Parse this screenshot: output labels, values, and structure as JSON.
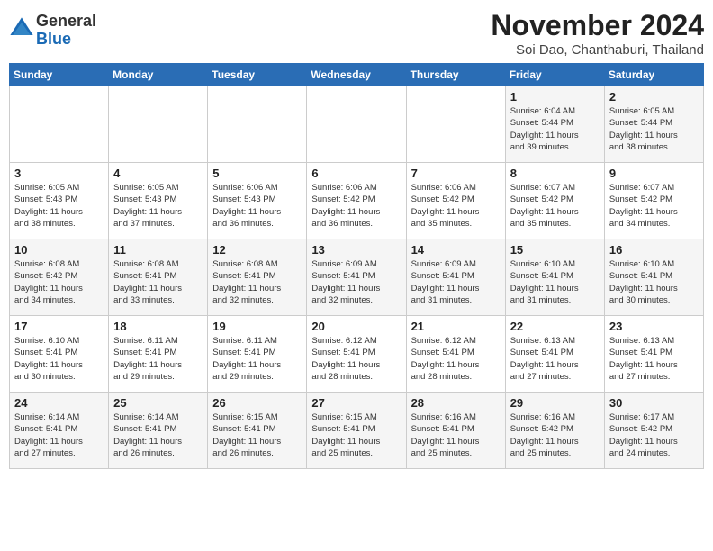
{
  "header": {
    "logo_general": "General",
    "logo_blue": "Blue",
    "month_title": "November 2024",
    "location": "Soi Dao, Chanthaburi, Thailand"
  },
  "days_of_week": [
    "Sunday",
    "Monday",
    "Tuesday",
    "Wednesday",
    "Thursday",
    "Friday",
    "Saturday"
  ],
  "weeks": [
    [
      {
        "day": "",
        "info": ""
      },
      {
        "day": "",
        "info": ""
      },
      {
        "day": "",
        "info": ""
      },
      {
        "day": "",
        "info": ""
      },
      {
        "day": "",
        "info": ""
      },
      {
        "day": "1",
        "info": "Sunrise: 6:04 AM\nSunset: 5:44 PM\nDaylight: 11 hours\nand 39 minutes."
      },
      {
        "day": "2",
        "info": "Sunrise: 6:05 AM\nSunset: 5:44 PM\nDaylight: 11 hours\nand 38 minutes."
      }
    ],
    [
      {
        "day": "3",
        "info": "Sunrise: 6:05 AM\nSunset: 5:43 PM\nDaylight: 11 hours\nand 38 minutes."
      },
      {
        "day": "4",
        "info": "Sunrise: 6:05 AM\nSunset: 5:43 PM\nDaylight: 11 hours\nand 37 minutes."
      },
      {
        "day": "5",
        "info": "Sunrise: 6:06 AM\nSunset: 5:43 PM\nDaylight: 11 hours\nand 36 minutes."
      },
      {
        "day": "6",
        "info": "Sunrise: 6:06 AM\nSunset: 5:42 PM\nDaylight: 11 hours\nand 36 minutes."
      },
      {
        "day": "7",
        "info": "Sunrise: 6:06 AM\nSunset: 5:42 PM\nDaylight: 11 hours\nand 35 minutes."
      },
      {
        "day": "8",
        "info": "Sunrise: 6:07 AM\nSunset: 5:42 PM\nDaylight: 11 hours\nand 35 minutes."
      },
      {
        "day": "9",
        "info": "Sunrise: 6:07 AM\nSunset: 5:42 PM\nDaylight: 11 hours\nand 34 minutes."
      }
    ],
    [
      {
        "day": "10",
        "info": "Sunrise: 6:08 AM\nSunset: 5:42 PM\nDaylight: 11 hours\nand 34 minutes."
      },
      {
        "day": "11",
        "info": "Sunrise: 6:08 AM\nSunset: 5:41 PM\nDaylight: 11 hours\nand 33 minutes."
      },
      {
        "day": "12",
        "info": "Sunrise: 6:08 AM\nSunset: 5:41 PM\nDaylight: 11 hours\nand 32 minutes."
      },
      {
        "day": "13",
        "info": "Sunrise: 6:09 AM\nSunset: 5:41 PM\nDaylight: 11 hours\nand 32 minutes."
      },
      {
        "day": "14",
        "info": "Sunrise: 6:09 AM\nSunset: 5:41 PM\nDaylight: 11 hours\nand 31 minutes."
      },
      {
        "day": "15",
        "info": "Sunrise: 6:10 AM\nSunset: 5:41 PM\nDaylight: 11 hours\nand 31 minutes."
      },
      {
        "day": "16",
        "info": "Sunrise: 6:10 AM\nSunset: 5:41 PM\nDaylight: 11 hours\nand 30 minutes."
      }
    ],
    [
      {
        "day": "17",
        "info": "Sunrise: 6:10 AM\nSunset: 5:41 PM\nDaylight: 11 hours\nand 30 minutes."
      },
      {
        "day": "18",
        "info": "Sunrise: 6:11 AM\nSunset: 5:41 PM\nDaylight: 11 hours\nand 29 minutes."
      },
      {
        "day": "19",
        "info": "Sunrise: 6:11 AM\nSunset: 5:41 PM\nDaylight: 11 hours\nand 29 minutes."
      },
      {
        "day": "20",
        "info": "Sunrise: 6:12 AM\nSunset: 5:41 PM\nDaylight: 11 hours\nand 28 minutes."
      },
      {
        "day": "21",
        "info": "Sunrise: 6:12 AM\nSunset: 5:41 PM\nDaylight: 11 hours\nand 28 minutes."
      },
      {
        "day": "22",
        "info": "Sunrise: 6:13 AM\nSunset: 5:41 PM\nDaylight: 11 hours\nand 27 minutes."
      },
      {
        "day": "23",
        "info": "Sunrise: 6:13 AM\nSunset: 5:41 PM\nDaylight: 11 hours\nand 27 minutes."
      }
    ],
    [
      {
        "day": "24",
        "info": "Sunrise: 6:14 AM\nSunset: 5:41 PM\nDaylight: 11 hours\nand 27 minutes."
      },
      {
        "day": "25",
        "info": "Sunrise: 6:14 AM\nSunset: 5:41 PM\nDaylight: 11 hours\nand 26 minutes."
      },
      {
        "day": "26",
        "info": "Sunrise: 6:15 AM\nSunset: 5:41 PM\nDaylight: 11 hours\nand 26 minutes."
      },
      {
        "day": "27",
        "info": "Sunrise: 6:15 AM\nSunset: 5:41 PM\nDaylight: 11 hours\nand 25 minutes."
      },
      {
        "day": "28",
        "info": "Sunrise: 6:16 AM\nSunset: 5:41 PM\nDaylight: 11 hours\nand 25 minutes."
      },
      {
        "day": "29",
        "info": "Sunrise: 6:16 AM\nSunset: 5:42 PM\nDaylight: 11 hours\nand 25 minutes."
      },
      {
        "day": "30",
        "info": "Sunrise: 6:17 AM\nSunset: 5:42 PM\nDaylight: 11 hours\nand 24 minutes."
      }
    ]
  ]
}
